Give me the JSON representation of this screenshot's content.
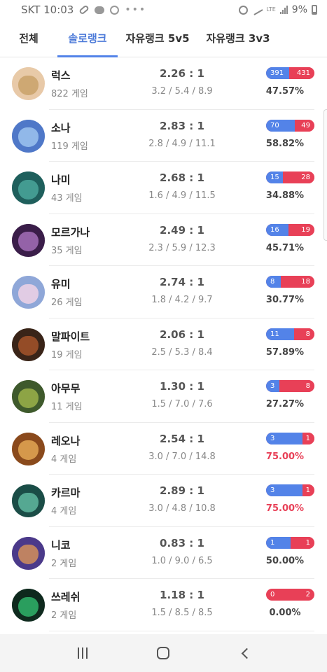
{
  "status": {
    "carrier_time": "SKT 10:03",
    "battery": "9%",
    "network": "LTE"
  },
  "tabs": [
    {
      "label": "전체"
    },
    {
      "label": "솔로랭크"
    },
    {
      "label": "자유랭크 5v5"
    },
    {
      "label": "자유랭크 3v3"
    }
  ],
  "active_tab": "솔로랭크",
  "colors": {
    "accent": "#5383e8",
    "win": "#5383e8",
    "loss": "#e84057"
  },
  "champions": [
    {
      "name": "럭스",
      "games": "822 게임",
      "kda_ratio": "2.26 : 1",
      "kda": "3.2 / 5.4 / 8.9",
      "wins": 391,
      "losses": 431,
      "win_label": "391",
      "loss_label": "431",
      "winrate": "47.57%",
      "hot": false,
      "avatar_colors": [
        "#e8c9a8",
        "#c9a26a"
      ]
    },
    {
      "name": "소나",
      "games": "119 게임",
      "kda_ratio": "2.83 : 1",
      "kda": "2.8 / 4.9 / 11.1",
      "wins": 70,
      "losses": 49,
      "win_label": "70",
      "loss_label": "49",
      "winrate": "58.82%",
      "hot": false,
      "avatar_colors": [
        "#4f78c8",
        "#9cc3ef"
      ]
    },
    {
      "name": "나미",
      "games": "43 게임",
      "kda_ratio": "2.68 : 1",
      "kda": "1.6 / 4.9 / 11.5",
      "wins": 15,
      "losses": 28,
      "win_label": "15",
      "loss_label": "28",
      "winrate": "34.88%",
      "hot": false,
      "avatar_colors": [
        "#1f5f5c",
        "#4aa69a"
      ]
    },
    {
      "name": "모르가나",
      "games": "35 게임",
      "kda_ratio": "2.49 : 1",
      "kda": "2.3 / 5.9 / 12.3",
      "wins": 16,
      "losses": 19,
      "win_label": "16",
      "loss_label": "19",
      "winrate": "45.71%",
      "hot": false,
      "avatar_colors": [
        "#3b1e4a",
        "#a56fb8"
      ]
    },
    {
      "name": "유미",
      "games": "26 게임",
      "kda_ratio": "2.74 : 1",
      "kda": "1.8 / 4.2 / 9.7",
      "wins": 8,
      "losses": 18,
      "win_label": "8",
      "loss_label": "18",
      "winrate": "30.77%",
      "hot": false,
      "avatar_colors": [
        "#8fa7d8",
        "#f0d2e6"
      ]
    },
    {
      "name": "말파이트",
      "games": "19 게임",
      "kda_ratio": "2.06 : 1",
      "kda": "2.5 / 5.3 / 8.4",
      "wins": 11,
      "losses": 8,
      "win_label": "11",
      "loss_label": "8",
      "winrate": "57.89%",
      "hot": false,
      "avatar_colors": [
        "#3a2418",
        "#a5532a"
      ]
    },
    {
      "name": "아무무",
      "games": "11 게임",
      "kda_ratio": "1.30 : 1",
      "kda": "1.5 / 7.0 / 7.6",
      "wins": 3,
      "losses": 8,
      "win_label": "3",
      "loss_label": "8",
      "winrate": "27.27%",
      "hot": false,
      "avatar_colors": [
        "#3f5a2c",
        "#9bb24a"
      ]
    },
    {
      "name": "레오나",
      "games": "4 게임",
      "kda_ratio": "2.54 : 1",
      "kda": "3.0 / 7.0 / 14.8",
      "wins": 3,
      "losses": 1,
      "win_label": "3",
      "loss_label": "1",
      "winrate": "75.00%",
      "hot": true,
      "avatar_colors": [
        "#8a4a1c",
        "#e2a653"
      ]
    },
    {
      "name": "카르마",
      "games": "4 게임",
      "kda_ratio": "2.89 : 1",
      "kda": "3.0 / 4.8 / 10.8",
      "wins": 3,
      "losses": 1,
      "win_label": "3",
      "loss_label": "1",
      "winrate": "75.00%",
      "hot": true,
      "avatar_colors": [
        "#1b4d47",
        "#5fb8a0"
      ]
    },
    {
      "name": "니코",
      "games": "2 게임",
      "kda_ratio": "0.83 : 1",
      "kda": "1.0 / 9.0 / 6.5",
      "wins": 1,
      "losses": 1,
      "win_label": "1",
      "loss_label": "1",
      "winrate": "50.00%",
      "hot": false,
      "avatar_colors": [
        "#4b3a8a",
        "#d28f5a"
      ]
    },
    {
      "name": "쓰레쉬",
      "games": "2 게임",
      "kda_ratio": "1.18 : 1",
      "kda": "1.5 / 8.5 / 8.5",
      "wins": 0,
      "losses": 2,
      "win_label": "0",
      "loss_label": "2",
      "winrate": "0.00%",
      "hot": false,
      "avatar_colors": [
        "#0f2a1e",
        "#2fb36a"
      ]
    }
  ]
}
